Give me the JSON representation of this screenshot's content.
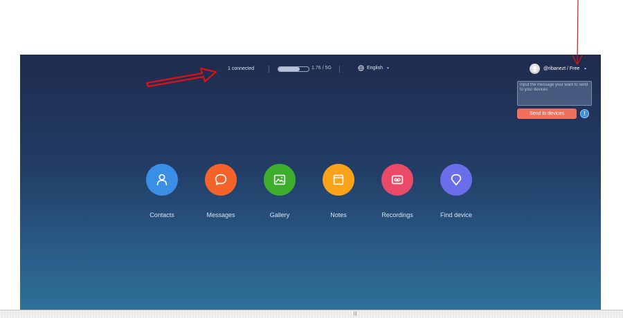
{
  "topbar": {
    "connected": "1 connected",
    "storage": {
      "used_fraction": 0.7,
      "label": "1.76 / 5G"
    },
    "language": "English",
    "account": "@ribanezt / Free"
  },
  "send_panel": {
    "placeholder": "Input the message your want to send to your devices",
    "send_label": "Send to devices",
    "info_label": "!"
  },
  "apps": [
    {
      "key": "contacts",
      "label": "Contacts",
      "color": "#3a8ee6",
      "icon": "person-icon"
    },
    {
      "key": "messages",
      "label": "Messages",
      "color": "#f4642a",
      "icon": "chat-bubble-icon"
    },
    {
      "key": "gallery",
      "label": "Gallery",
      "color": "#3dae2b",
      "icon": "image-icon"
    },
    {
      "key": "notes",
      "label": "Notes",
      "color": "#f8a31a",
      "icon": "note-icon"
    },
    {
      "key": "recordings",
      "label": "Recordings",
      "color": "#e84a67",
      "icon": "cassette-icon"
    },
    {
      "key": "find-device",
      "label": "Find device",
      "color": "#6a6ee8",
      "icon": "location-pin-icon"
    }
  ],
  "annotation_color": "#e01010",
  "status_strip": {
    "handle": "|||"
  }
}
